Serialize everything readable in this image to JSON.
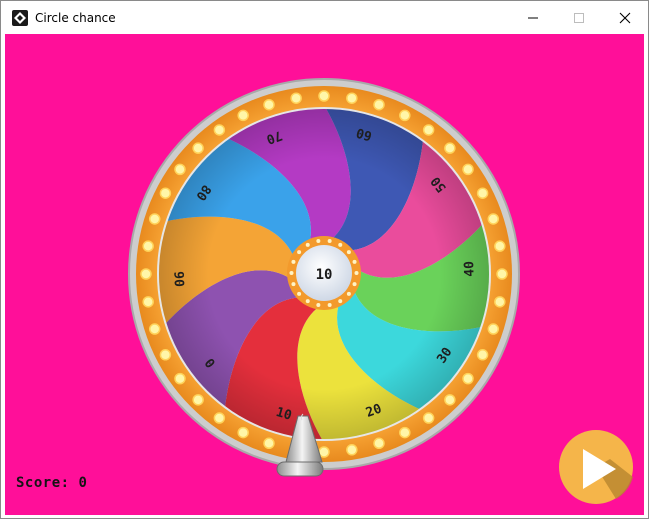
{
  "window": {
    "title": "Circle chance",
    "controls": [
      "minimize",
      "maximize",
      "close"
    ]
  },
  "wheel": {
    "center_label": "10",
    "segments": [
      {
        "label": "70",
        "color": "#b43ac4"
      },
      {
        "label": "60",
        "color": "#3e58b4"
      },
      {
        "label": "50",
        "color": "#ea4c9c"
      },
      {
        "label": "40",
        "color": "#6ad25a"
      },
      {
        "label": "30",
        "color": "#3cd8dc"
      },
      {
        "label": "20",
        "color": "#ece23c"
      },
      {
        "label": "10",
        "color": "#e42f3c"
      },
      {
        "label": "0",
        "color": "#8e52b0"
      },
      {
        "label": "90",
        "color": "#f4a436"
      },
      {
        "label": "80",
        "color": "#3aa2ea"
      }
    ]
  },
  "hud": {
    "score_text": "Score: 0"
  },
  "colors": {
    "background": "#ff0f99",
    "rim_orange": "#f39a2c",
    "rim_silver": "#c9c9c9",
    "bulb": "#fff3a0",
    "play_button": "#f5b54a"
  },
  "icons": {
    "pointer": "pointer-arrow-icon",
    "play": "play-icon"
  }
}
